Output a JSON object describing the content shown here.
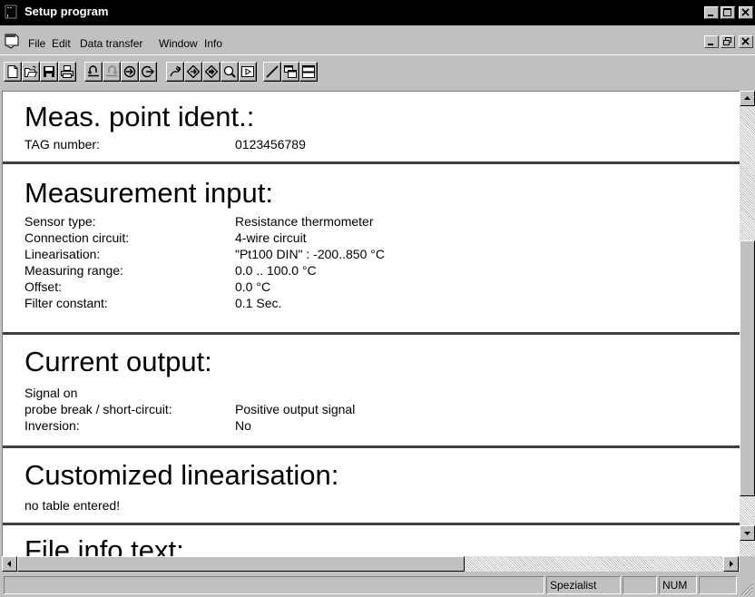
{
  "window": {
    "title": "Setup program"
  },
  "menu": {
    "items": [
      {
        "label": "File"
      },
      {
        "label": "Edit"
      },
      {
        "label": "Data transfer"
      },
      {
        "label": "Window"
      },
      {
        "label": "Info"
      }
    ]
  },
  "document": {
    "sections": [
      {
        "heading": "Meas. point ident.:",
        "rows": [
          {
            "label": "TAG number:",
            "value": "0123456789"
          }
        ]
      },
      {
        "heading": "Measurement input:",
        "rows": [
          {
            "label": "Sensor type:",
            "value": "Resistance thermometer"
          },
          {
            "label": "Connection circuit:",
            "value": "4-wire circuit"
          },
          {
            "label": "Linearisation:",
            "value": "\"Pt100 DIN\" : -200..850 °C"
          },
          {
            "label": "Measuring range:",
            "value": "0.0 .. 100.0 °C"
          },
          {
            "label": "Offset:",
            "value": "0.0 °C"
          },
          {
            "label": "Filter constant:",
            "value": "0.1 Sec."
          }
        ]
      },
      {
        "heading": "Current output:",
        "rows": [
          {
            "label": "Signal on",
            "value": ""
          },
          {
            "label": "probe break / short-circuit:",
            "value": "Positive output signal"
          },
          {
            "label": "Inversion:",
            "value": "No"
          }
        ]
      },
      {
        "heading": "Customized linearisation:",
        "rows": [
          {
            "label": "no table entered!",
            "value": ""
          }
        ]
      },
      {
        "heading": "File info text:",
        "rows": []
      }
    ]
  },
  "statusbar": {
    "user_level": "Spezialist",
    "num_lock": "NUM"
  }
}
